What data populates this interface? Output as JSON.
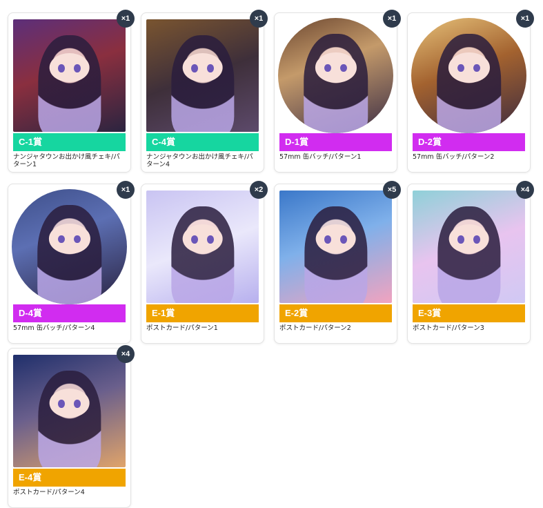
{
  "prizes": [
    {
      "tier": "C-1賞",
      "desc": "ナンジャタウンお出かけ風チェキ/パターン1",
      "qty": "×1",
      "tierColor": "#16d6a0",
      "shape": "square",
      "bg": "linear-gradient(160deg,#5c2f7a,#8a2f3f 45%,#2b2440 100%)"
    },
    {
      "tier": "C-4賞",
      "desc": "ナンジャタウンお出かけ風チェキ/パターン4",
      "qty": "×1",
      "tierColor": "#16d6a0",
      "shape": "square",
      "bg": "linear-gradient(160deg,#7a5530,#3e2f3a 50%,#5d4a6b 100%)"
    },
    {
      "tier": "D-1賞",
      "desc": "57mm 缶バッチ/パターン1",
      "qty": "×1",
      "tierColor": "#d12cf0",
      "shape": "circle",
      "bg": "linear-gradient(160deg,#6b4630,#c49a6a 40%,#3a2c45 100%)"
    },
    {
      "tier": "D-2賞",
      "desc": "57mm 缶バッチ/パターン2",
      "qty": "×1",
      "tierColor": "#d12cf0",
      "shape": "circle",
      "bg": "linear-gradient(160deg,#e7c27a,#a3622f 45%,#3b2a3f 100%)"
    },
    {
      "tier": "D-4賞",
      "desc": "57mm 缶バッチ/パターン4",
      "qty": "×1",
      "tierColor": "#d12cf0",
      "shape": "circle",
      "bg": "linear-gradient(160deg,#3e4f8a,#5c6fb3 40%,#2a2240 100%)"
    },
    {
      "tier": "E-1賞",
      "desc": "ポストカード/パターン1",
      "qty": "×2",
      "tierColor": "#f0a400",
      "shape": "square",
      "bg": "linear-gradient(160deg,#c9c4f2,#eae8fb 50%,#b7b0ee 100%)"
    },
    {
      "tier": "E-2賞",
      "desc": "ポストカード/パターン2",
      "qty": "×5",
      "tierColor": "#f0a400",
      "shape": "square",
      "bg": "linear-gradient(160deg,#3b78c9,#7fb0ea 45%,#f1a3bf 100%)"
    },
    {
      "tier": "E-3賞",
      "desc": "ポストカード/パターン3",
      "qty": "×4",
      "tierColor": "#f0a400",
      "shape": "square",
      "bg": "linear-gradient(160deg,#8fd0d8,#e8c4ef 50%,#d0c9f4 100%)"
    },
    {
      "tier": "E-4賞",
      "desc": "ポストカード/パターン4",
      "qty": "×4",
      "tierColor": "#f0a400",
      "shape": "square",
      "bg": "linear-gradient(160deg,#1f2f6b,#6a5f8c 45%,#e0a46a 100%)"
    }
  ]
}
